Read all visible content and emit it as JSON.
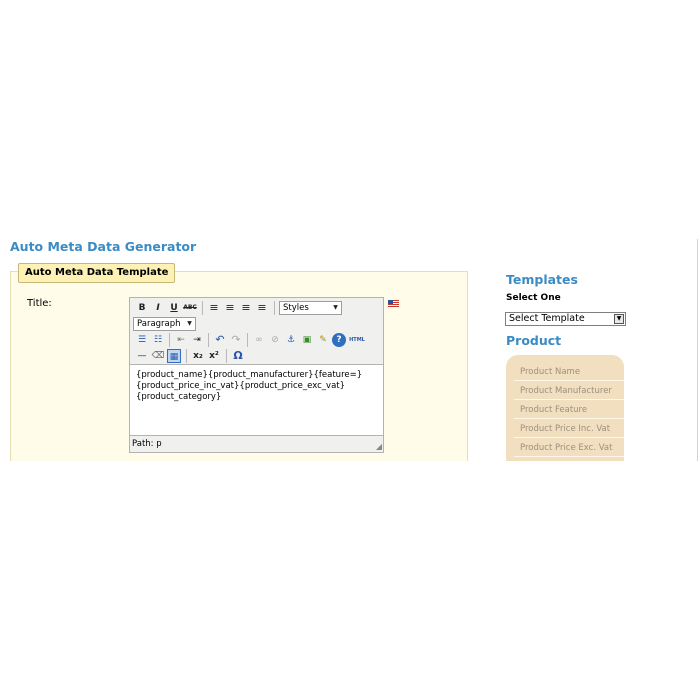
{
  "page": {
    "heading": "Auto Meta Data Generator",
    "legend": "Auto Meta Data Template",
    "title_label": "Title:"
  },
  "editor": {
    "toolbar_row1": [
      {
        "icon": "bold-icon",
        "glyph": "B"
      },
      {
        "icon": "italic-icon",
        "glyph": "I"
      },
      {
        "icon": "underline-icon",
        "glyph": "U"
      },
      {
        "icon": "strikethrough-icon",
        "glyph": "ABC"
      },
      {
        "icon": "align-left-icon",
        "glyph": "≡"
      },
      {
        "icon": "align-center-icon",
        "glyph": "≡"
      },
      {
        "icon": "align-right-icon",
        "glyph": "≡"
      },
      {
        "icon": "align-justify-icon",
        "glyph": "≡"
      }
    ],
    "styles_select": "Styles",
    "format_select": "Paragraph",
    "toolbar_row3": [
      {
        "icon": "bullet-list-icon",
        "glyph": "☰"
      },
      {
        "icon": "numbered-list-icon",
        "glyph": "☷"
      },
      {
        "icon": "outdent-icon",
        "glyph": "⇤"
      },
      {
        "icon": "indent-icon",
        "glyph": "⇥"
      },
      {
        "icon": "undo-icon",
        "glyph": "↶"
      },
      {
        "icon": "redo-icon",
        "glyph": "↷"
      },
      {
        "icon": "link-icon",
        "glyph": "∞"
      },
      {
        "icon": "unlink-icon",
        "glyph": "⊘"
      },
      {
        "icon": "anchor-icon",
        "glyph": "⚓"
      },
      {
        "icon": "image-icon",
        "glyph": "▣"
      },
      {
        "icon": "cleanup-icon",
        "glyph": "✎"
      },
      {
        "icon": "help-icon",
        "glyph": "?"
      },
      {
        "icon": "html-icon",
        "glyph": "HTML"
      }
    ],
    "toolbar_row4": [
      {
        "icon": "horizontal-rule-icon",
        "glyph": "—"
      },
      {
        "icon": "remove-format-icon",
        "glyph": "⌫"
      },
      {
        "icon": "visual-aid-icon",
        "glyph": "▦"
      },
      {
        "icon": "subscript-icon",
        "glyph": "x₂"
      },
      {
        "icon": "superscript-icon",
        "glyph": "x²"
      },
      {
        "icon": "special-char-icon",
        "glyph": "Ω"
      }
    ],
    "content": "{product_name}{product_manufacturer}{feature=}\n{product_price_inc_vat}{product_price_exc_vat}\n{product_category}",
    "path_label": "Path: p"
  },
  "sidebar": {
    "templates_heading": "Templates",
    "select_one_label": "Select One",
    "template_select": "Select Template",
    "product_heading": "Product",
    "product_items": [
      "Product Name",
      "Product Manufacturer",
      "Product Feature",
      "Product Price Inc. Vat",
      "Product Price Exc. Vat"
    ]
  },
  "colors": {
    "heading_blue": "#3b8bc4",
    "fieldset_bg": "#fffde9",
    "legend_bg": "#fdf1b5",
    "product_panel_bg": "#f2dfbf"
  }
}
